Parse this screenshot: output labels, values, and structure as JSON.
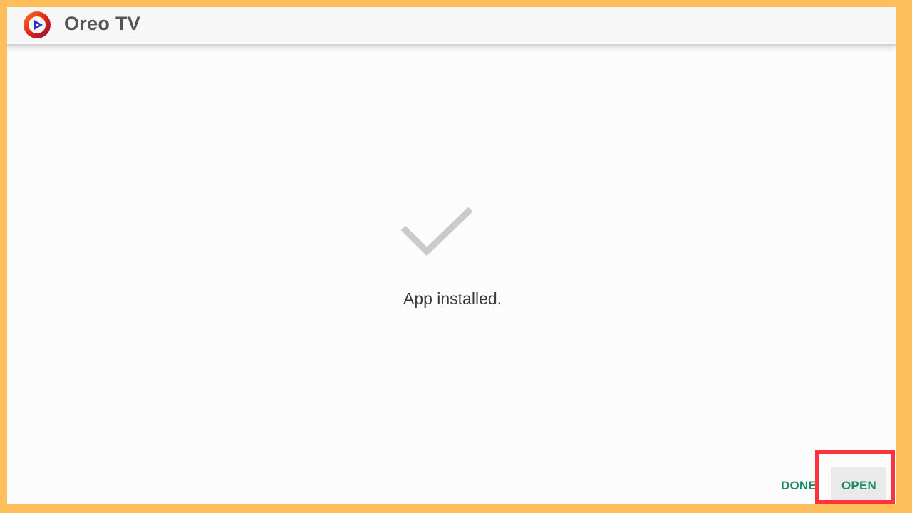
{
  "header": {
    "app_name": "Oreo TV",
    "logo_icon": "oreo-tv-logo-icon"
  },
  "main": {
    "status_icon": "checkmark-icon",
    "status_text": "App installed."
  },
  "actions": {
    "done_label": "DONE",
    "open_label": "OPEN"
  },
  "colors": {
    "frame": "#ffbe5c",
    "button_text": "#1f8a6b",
    "highlight": "#ff333b",
    "checkmark": "#c8cbcb"
  }
}
